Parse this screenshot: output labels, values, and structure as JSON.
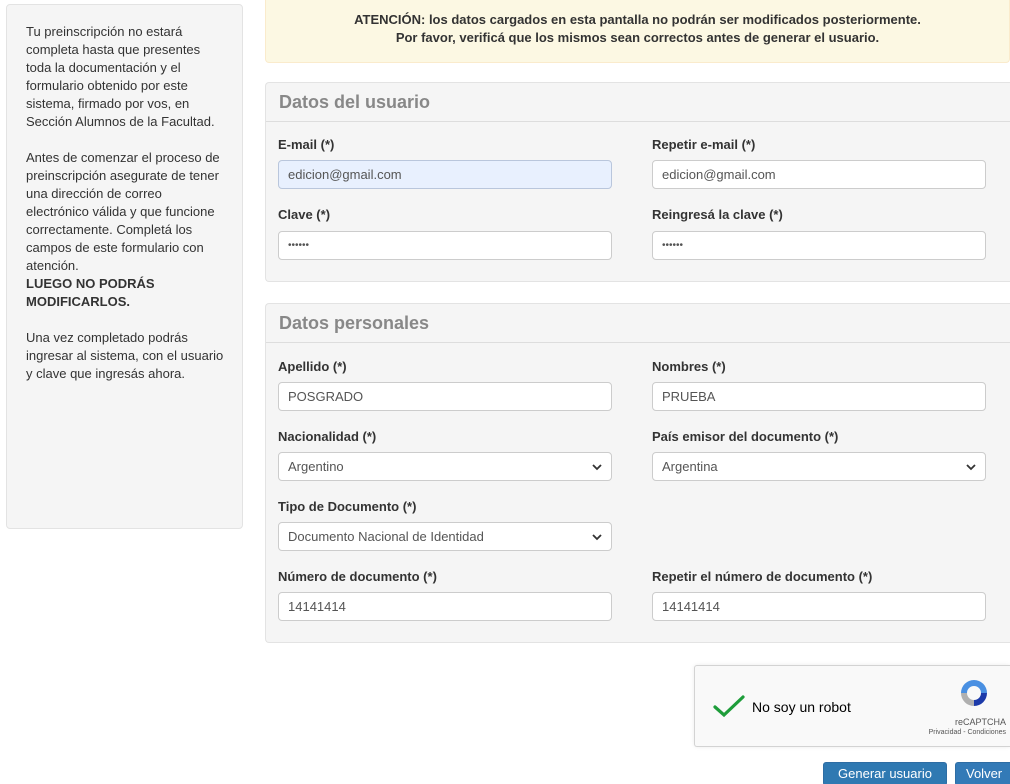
{
  "sidebar": {
    "p1": "Tu preinscripción no estará completa hasta que presentes toda la documentación y el formulario obtenido por este sistema, firmado por vos, en Sección Alumnos de la Facultad.",
    "p2": "Antes de comenzar el proceso de preinscripción asegurate de tener una dirección de correo electrónico válida y que funcione correctamente. Completá los campos de este formulario con atención.",
    "p2_strong": "LUEGO NO PODRÁS MODIFICARLOS.",
    "p3": "Una vez completado podrás ingresar al sistema, con el usuario y clave que ingresás ahora."
  },
  "alert": {
    "line1": "ATENCIÓN: los datos cargados en esta pantalla no podrán ser modificados posteriormente.",
    "line2": "Por favor, verificá que los mismos sean correctos antes de generar el usuario."
  },
  "usuario": {
    "title": "Datos del usuario",
    "email_label": "E-mail (*)",
    "email_value": "edicion@gmail.com",
    "email2_label": "Repetir e-mail (*)",
    "email2_value": "edicion@gmail.com",
    "clave_label": "Clave (*)",
    "clave_value": "••••••",
    "clave2_label": "Reingresá la clave (*)",
    "clave2_value": "••••••"
  },
  "personales": {
    "title": "Datos personales",
    "apellido_label": "Apellido (*)",
    "apellido_value": "POSGRADO",
    "nombres_label": "Nombres (*)",
    "nombres_value": "PRUEBA",
    "nacionalidad_label": "Nacionalidad (*)",
    "nacionalidad_value": "Argentino",
    "pais_label": "País emisor del documento (*)",
    "pais_value": "Argentina",
    "tipo_label": "Tipo de Documento (*)",
    "tipo_value": "Documento Nacional de Identidad",
    "numero_label": "Número de documento (*)",
    "numero_value": "14141414",
    "numero2_label": "Repetir el número de documento (*)",
    "numero2_value": "14141414"
  },
  "captcha": {
    "label": "No soy un robot",
    "brand": "reCAPTCHA",
    "links": "Privacidad - Condiciones"
  },
  "buttons": {
    "generar": "Generar usuario",
    "volver": "Volver"
  }
}
